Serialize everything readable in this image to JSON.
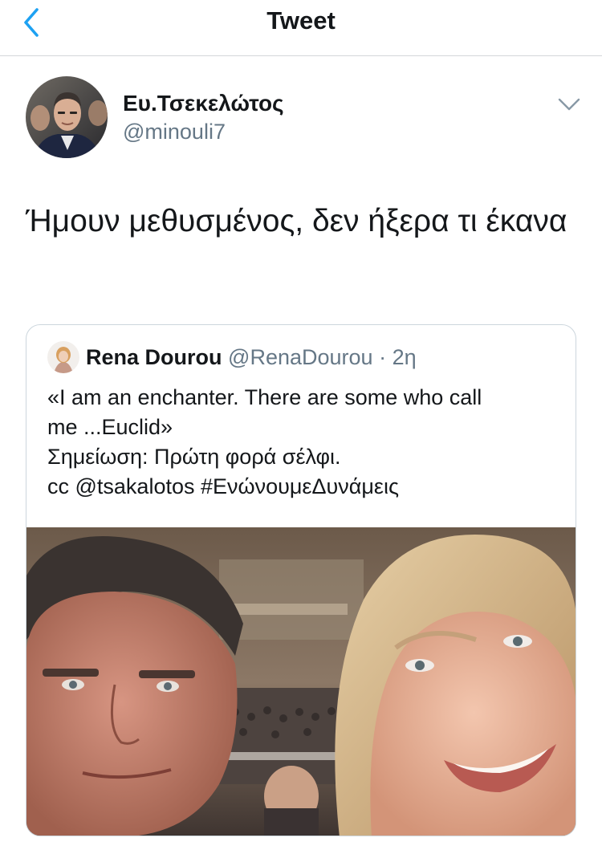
{
  "nav": {
    "title": "Tweet",
    "back_icon": "chevron-left-icon",
    "accent_color": "#1da1f2"
  },
  "tweet": {
    "author": {
      "display_name": "Ευ.Τσεκελώτος",
      "handle": "@minouli7"
    },
    "menu_icon": "chevron-down-icon",
    "text": "Ήμουν μεθυσμένος, δεν ήξερα τι έκανα"
  },
  "quoted_tweet": {
    "author": {
      "display_name": "Rena Dourou",
      "handle": "@RenaDourou",
      "separator": "·",
      "time": "2η"
    },
    "text_lines": [
      "«I am an enchanter. There are some who call",
      "me ...Euclid»",
      "Σημείωση: Πρώτη φορά σέλφι.",
      "cc @tsakalotos #ΕνώνουμεΔυνάμεις"
    ]
  },
  "colors": {
    "text_primary": "#14171a",
    "text_secondary": "#657786",
    "border": "#ccd6dd"
  }
}
